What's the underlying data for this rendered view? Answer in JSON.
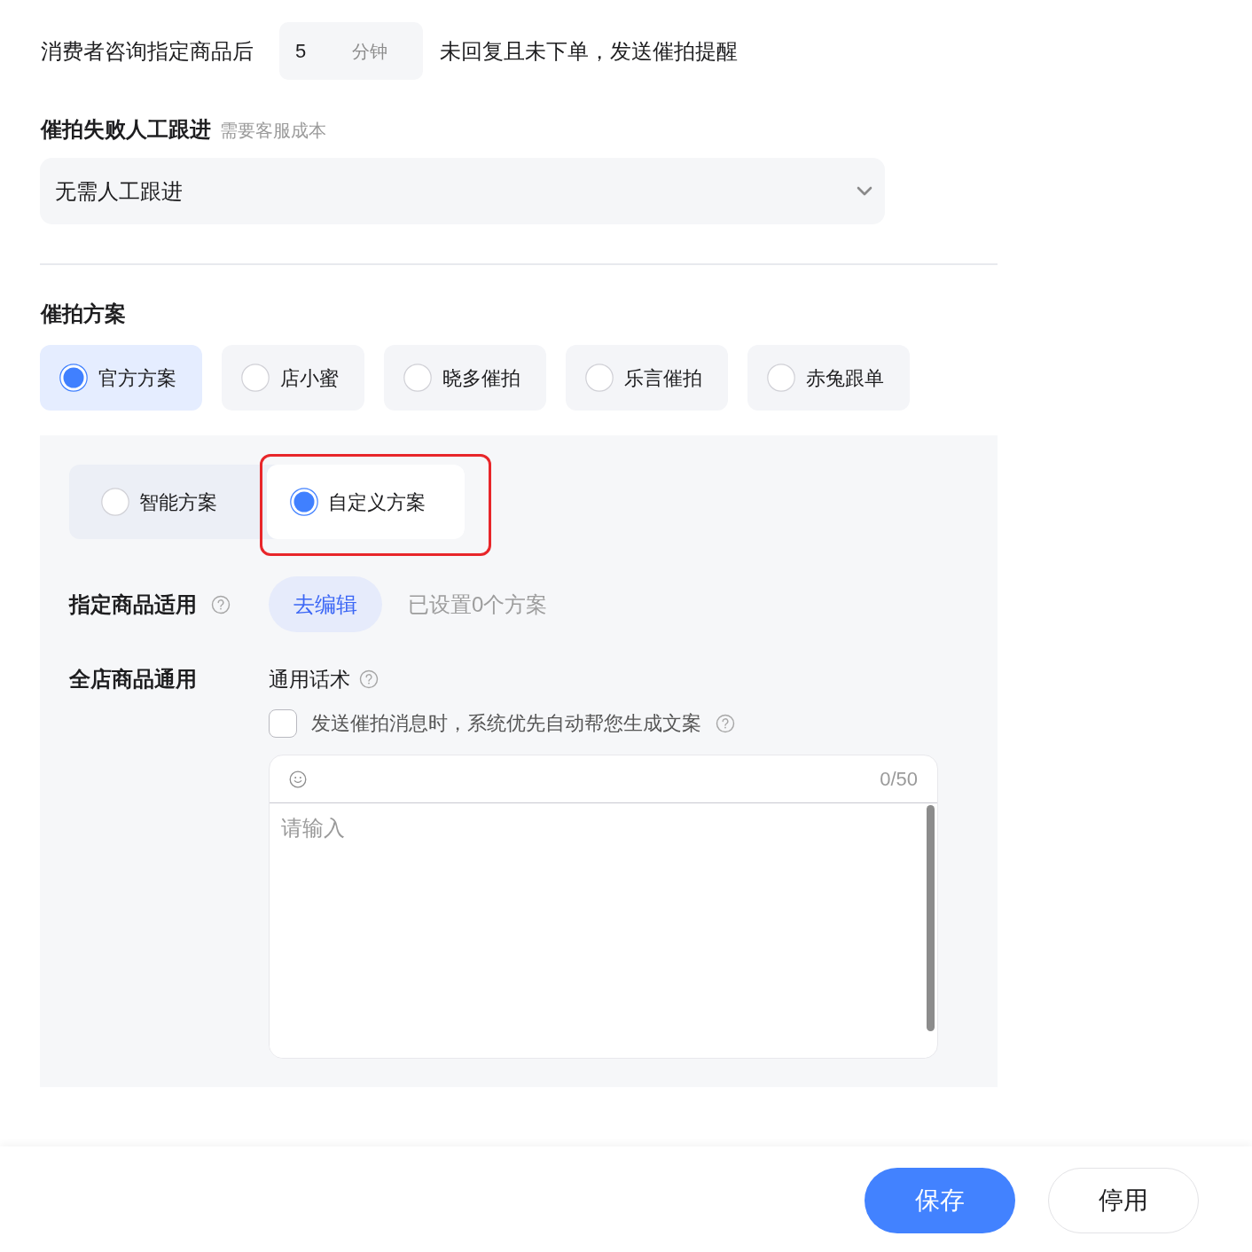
{
  "reminder_rule": {
    "prefix": "消费者咨询指定商品后",
    "delay_value": "5",
    "delay_unit": "分钟",
    "suffix": "未回复且未下单，发送催拍提醒"
  },
  "manual_followup": {
    "label": "催拍失败人工跟进",
    "hint": "需要客服成本",
    "value": "无需人工跟进"
  },
  "plan": {
    "label": "催拍方案",
    "options": [
      {
        "label": "官方方案",
        "selected": true
      },
      {
        "label": "店小蜜",
        "selected": false
      },
      {
        "label": "晓多催拍",
        "selected": false
      },
      {
        "label": "乐言催拍",
        "selected": false
      },
      {
        "label": "赤兔跟单",
        "selected": false
      }
    ],
    "sub_options": [
      {
        "label": "智能方案",
        "selected": false,
        "highlighted": false
      },
      {
        "label": "自定义方案",
        "selected": true,
        "highlighted": true
      }
    ],
    "specific_products": {
      "label": "指定商品适用",
      "button": "去编辑",
      "status": "已设置0个方案"
    },
    "all_products": {
      "label": "全店商品通用",
      "script_label": "通用话术",
      "auto_generate": {
        "label": "发送催拍消息时，系统优先自动帮您生成文案",
        "checked": false
      },
      "editor": {
        "counter": "0/50",
        "placeholder": "请输入"
      }
    }
  },
  "footer": {
    "buttons": [
      {
        "label": "保存",
        "kind": "primary"
      },
      {
        "label": "停用",
        "kind": "secondary"
      }
    ]
  }
}
